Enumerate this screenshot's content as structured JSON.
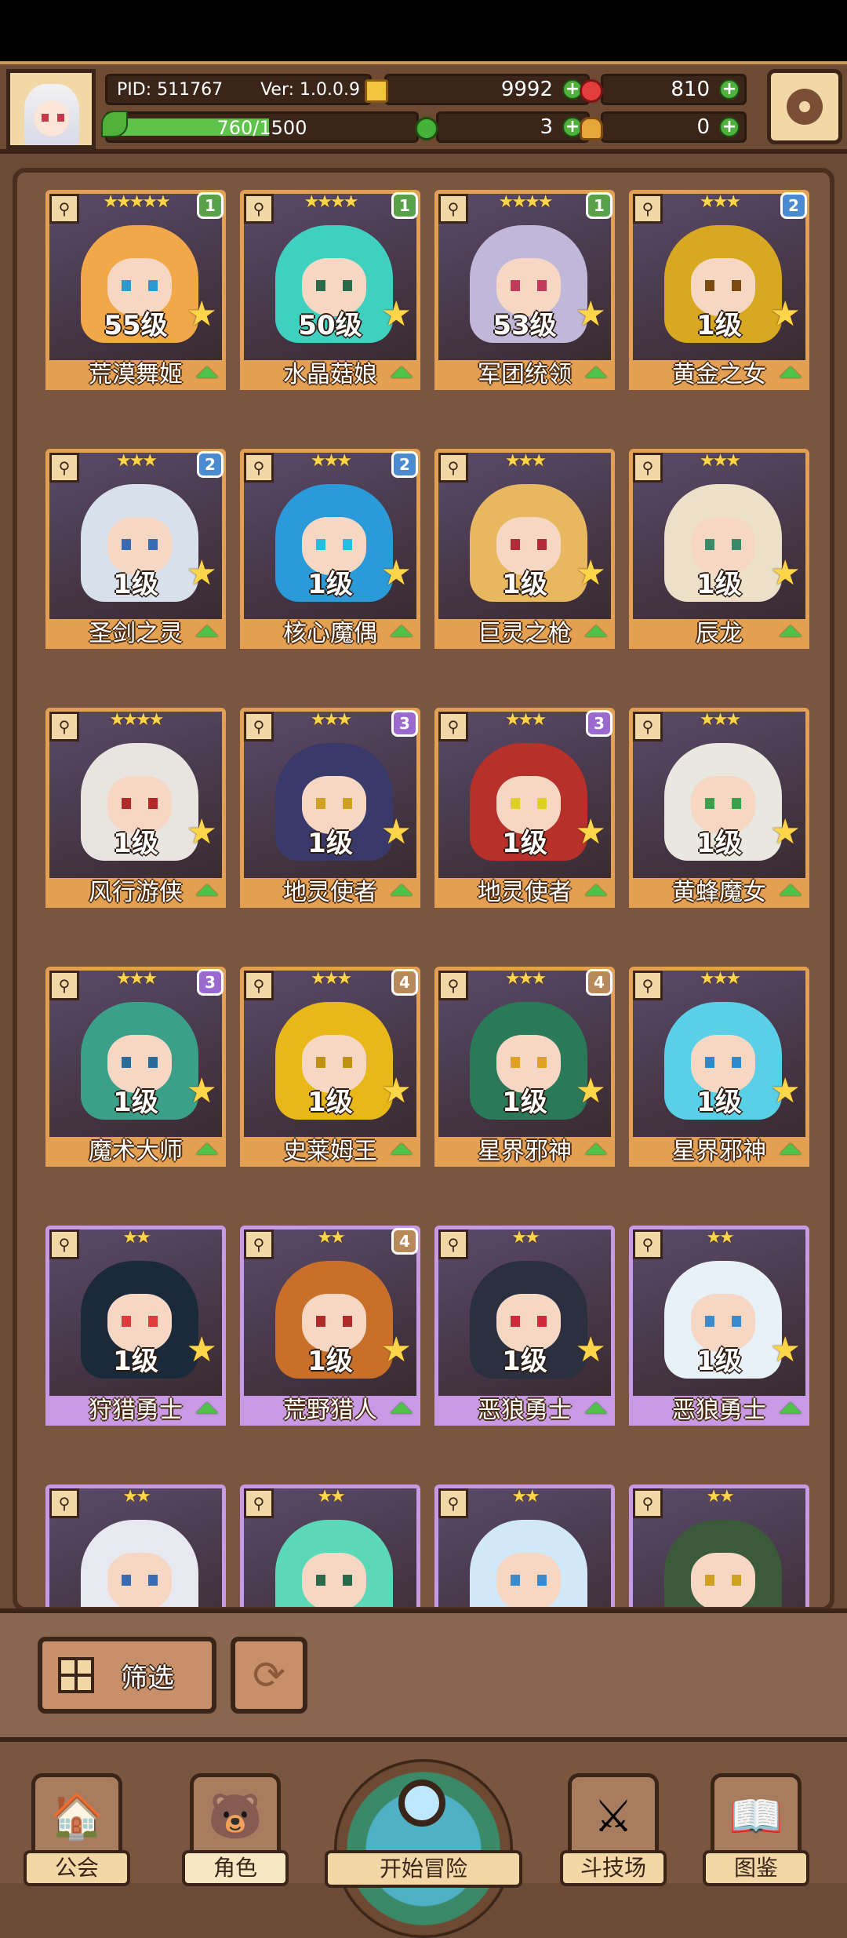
{
  "player": {
    "pid": "PID: 511767",
    "version": "Ver: 1.0.0.9",
    "xp": "760/1500",
    "xp_progress": 0.507
  },
  "resources": {
    "coins": "9992",
    "gems": "810",
    "clover": "3",
    "bell": "0"
  },
  "cards": [
    {
      "name": "荒漠舞姬",
      "level": "55级",
      "stars": "★★★★★",
      "badge": "1",
      "frame": "orange",
      "hair": "#f0a848",
      "eye": "#2a9ad0"
    },
    {
      "name": "水晶菇娘",
      "level": "50级",
      "stars": "★★★★",
      "badge": "1",
      "frame": "orange",
      "hair": "#3fd0c0",
      "eye": "#2a6a4a"
    },
    {
      "name": "军团统领",
      "level": "53级",
      "stars": "★★★★",
      "badge": "1",
      "frame": "orange",
      "hair": "#c0b8d8",
      "eye": "#c03a5a"
    },
    {
      "name": "黄金之女",
      "level": "1级",
      "stars": "★★★",
      "badge": "2",
      "frame": "orange",
      "hair": "#d8a820",
      "eye": "#7a4a10"
    },
    {
      "name": "圣剑之灵",
      "level": "1级",
      "stars": "★★★",
      "badge": "2",
      "frame": "orange",
      "hair": "#d8e0ec",
      "eye": "#3a6ab0"
    },
    {
      "name": "核心魔偶",
      "level": "1级",
      "stars": "★★★",
      "badge": "2",
      "frame": "orange",
      "hair": "#2a9ad8",
      "eye": "#20c0e0"
    },
    {
      "name": "巨灵之枪",
      "level": "1级",
      "stars": "★★★",
      "badge": "",
      "frame": "orange",
      "hair": "#e8b860",
      "eye": "#b02a3a"
    },
    {
      "name": "辰龙",
      "level": "1级",
      "stars": "★★★",
      "badge": "",
      "frame": "orange",
      "hair": "#ece0c8",
      "eye": "#3a8a6a"
    },
    {
      "name": "风行游侠",
      "level": "1级",
      "stars": "★★★★",
      "badge": "",
      "frame": "orange",
      "hair": "#e8e4e0",
      "eye": "#b02a2a"
    },
    {
      "name": "地灵使者",
      "level": "1级",
      "stars": "★★★",
      "badge": "3",
      "frame": "orange",
      "hair": "#3a3a6a",
      "eye": "#d0a020"
    },
    {
      "name": "地灵使者",
      "level": "1级",
      "stars": "★★★",
      "badge": "3",
      "frame": "orange",
      "hair": "#b8302a",
      "eye": "#e0d020"
    },
    {
      "name": "黄蜂魔女",
      "level": "1级",
      "stars": "★★★",
      "badge": "",
      "frame": "orange",
      "hair": "#e8e8e0",
      "eye": "#3aa04a"
    },
    {
      "name": "魔术大师",
      "level": "1级",
      "stars": "★★★",
      "badge": "3",
      "frame": "orange",
      "hair": "#3aa08a",
      "eye": "#2a6a9a"
    },
    {
      "name": "史莱姆王",
      "level": "1级",
      "stars": "★★★",
      "badge": "4",
      "frame": "orange",
      "hair": "#e8b818",
      "eye": "#c09010"
    },
    {
      "name": "星界邪神",
      "level": "1级",
      "stars": "★★★",
      "badge": "4",
      "frame": "orange",
      "hair": "#2a7a5a",
      "eye": "#e0a020"
    },
    {
      "name": "星界邪神",
      "level": "1级",
      "stars": "★★★",
      "badge": "",
      "frame": "orange",
      "hair": "#5ad0e8",
      "eye": "#2a8ad0"
    },
    {
      "name": "狩猎勇士",
      "level": "1级",
      "stars": "★★",
      "badge": "",
      "frame": "purple",
      "hair": "#1a2a3a",
      "eye": "#e03a3a"
    },
    {
      "name": "荒野猎人",
      "level": "1级",
      "stars": "★★",
      "badge": "4",
      "frame": "purple",
      "hair": "#c8702a",
      "eye": "#b02a2a"
    },
    {
      "name": "恶狼勇士",
      "level": "1级",
      "stars": "★★",
      "badge": "",
      "frame": "purple",
      "hair": "#2a3040",
      "eye": "#d02a3a"
    },
    {
      "name": "恶狼勇士",
      "level": "1级",
      "stars": "★★",
      "badge": "",
      "frame": "purple",
      "hair": "#e8f0f8",
      "eye": "#3a8ad0"
    },
    {
      "name": "",
      "level": "",
      "stars": "★★",
      "badge": "",
      "frame": "purple",
      "hair": "#e8e8f0",
      "eye": "#3a6ab0"
    },
    {
      "name": "",
      "level": "",
      "stars": "★★",
      "badge": "",
      "frame": "purple",
      "hair": "#5ad8b8",
      "eye": "#2a6a4a"
    },
    {
      "name": "",
      "level": "",
      "stars": "★★",
      "badge": "",
      "frame": "purple",
      "hair": "#d0e8f8",
      "eye": "#3a8ad0"
    },
    {
      "name": "",
      "level": "",
      "stars": "★★",
      "badge": "",
      "frame": "purple",
      "hair": "#3a5a3a",
      "eye": "#d0a020"
    }
  ],
  "toolbar": {
    "filter_label": "筛选",
    "filter_icon": "grid-icon",
    "reset_icon": "refresh-icon"
  },
  "nav": {
    "guild": "公会",
    "character": "角色",
    "adventure": "开始冒险",
    "arena": "斗技场",
    "codex": "图鉴"
  }
}
